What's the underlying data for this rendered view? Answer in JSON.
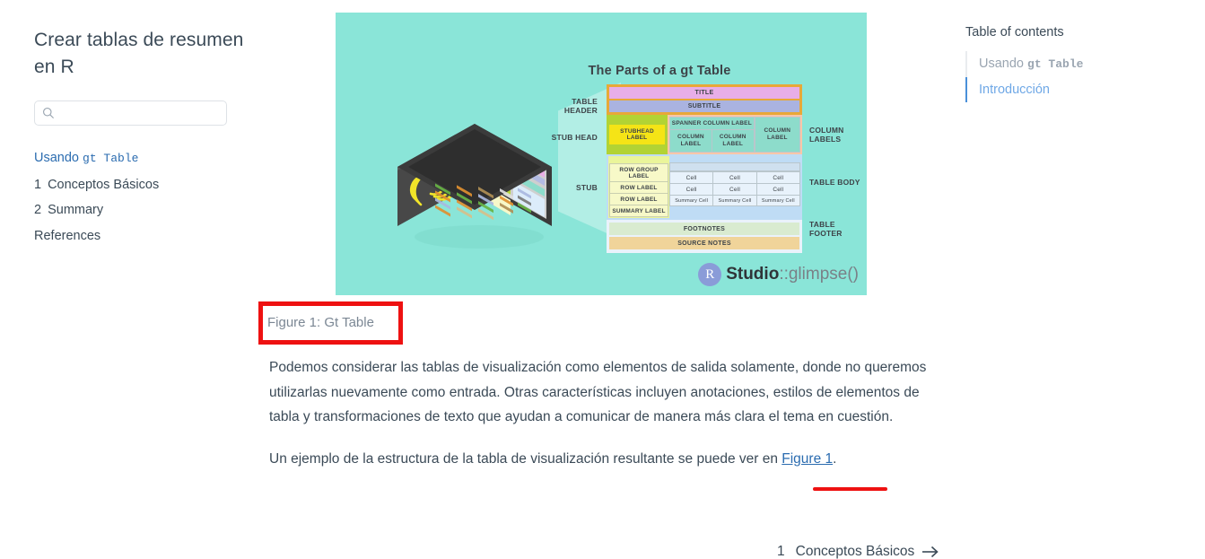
{
  "sidebar": {
    "site_title": "Crear tablas de resumen en R",
    "search": {
      "placeholder": "",
      "value": "",
      "icon": "search-icon"
    },
    "nav_items": [
      {
        "num": "",
        "label_plain": "Usando ",
        "label_mono": "gt Table",
        "active": true
      },
      {
        "num": "1",
        "label_plain": "Conceptos Básicos",
        "label_mono": "",
        "active": false
      },
      {
        "num": "2",
        "label_plain": "Summary",
        "label_mono": "",
        "active": false
      },
      {
        "num": "",
        "label_plain": "References",
        "label_mono": "",
        "active": false
      }
    ]
  },
  "toc": {
    "title": "Table of contents",
    "items": [
      {
        "label_plain": "Usando ",
        "label_mono": "gt Table",
        "active": false
      },
      {
        "label_plain": "Introducción",
        "label_mono": "",
        "active": true
      }
    ]
  },
  "figure": {
    "caption": "Figure 1: Gt Table",
    "background_color": "#8ae5d8",
    "illustration": {
      "title": "The Parts of a gt Table",
      "labels_left": [
        "TABLE HEADER",
        "STUB HEAD",
        "STUB"
      ],
      "labels_right": [
        "COLUMN LABELS",
        "TABLE BODY",
        "TABLE FOOTER"
      ],
      "header": {
        "title": "TITLE",
        "subtitle": "SUBTITLE"
      },
      "stubhead_label": "STUBHEAD LABEL",
      "spanner_column_label": "SPANNER COLUMN LABEL",
      "column_labels": [
        "COLUMN LABEL",
        "COLUMN LABEL",
        "COLUMN LABEL"
      ],
      "stub_cells": [
        "ROW GROUP LABEL",
        "ROW LABEL",
        "ROW LABEL",
        "SUMMARY LABEL"
      ],
      "body_rows": [
        [
          "Cell",
          "Cell",
          "Cell"
        ],
        [
          "Cell",
          "Cell",
          "Cell"
        ],
        [
          "Summary Cell",
          "Summary Cell",
          "Summary Cell"
        ]
      ],
      "footer": {
        "footnotes": "FOOTNOTES",
        "source_notes": "SOURCE NOTES"
      },
      "logo": {
        "mark": "R",
        "bold": "Studio",
        "dim": "::glimpse()"
      },
      "colors": {
        "background": "#8ae5d8",
        "title_cell": "#e8aee8",
        "subtitle_cell": "#aab3e0",
        "header_border": "#e8a838",
        "stubhead_col": "#b2d334",
        "stubhead_cell": "#f5e416",
        "column_labels": "#8ddccb",
        "column_labels_border": "#f9c6a8",
        "stub_col": "#eaf59a",
        "body": "#bfdcf5",
        "footnotes": "#d9ebd0",
        "source_notes": "#f0d49a"
      }
    }
  },
  "content": {
    "paragraph_1": "Podemos considerar las tablas de visualización como elementos de salida solamente, donde no queremos utilizarlas nuevamente como entrada. Otras características incluyen anotaciones, estilos de elementos de tabla y transformaciones de texto que ayudan a comunicar de manera más clara el tema en cuestión.",
    "paragraph_2_before": "Un ejemplo de la estructura de la tabla de visualización resultante se puede ver en ",
    "paragraph_2_link": "Figure 1",
    "paragraph_2_after": "."
  },
  "bottom_nav": {
    "num": "1",
    "label": "Conceptos Básicos",
    "icon": "arrow-right-icon"
  },
  "annotations": {
    "caption_box_color": "#ee1111",
    "link_underline_color": "#ee1111"
  }
}
